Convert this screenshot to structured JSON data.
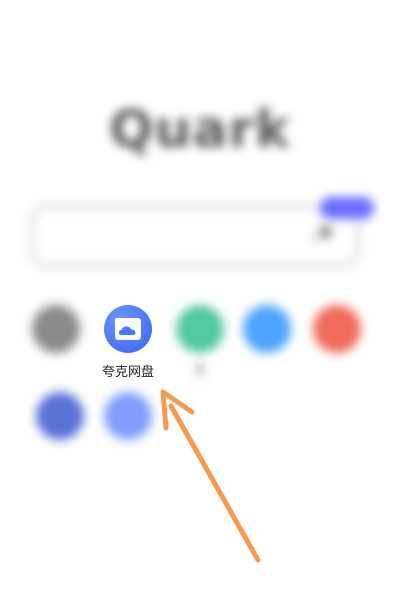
{
  "logo": {
    "text": "Quark"
  },
  "search": {
    "placeholder": ""
  },
  "shortcuts": [
    {
      "label": "",
      "color": "#8a8a8a",
      "icon": "app-icon"
    },
    {
      "label": "夸克网盘",
      "color": "#4a73ff",
      "icon": "cloud-drive-icon"
    },
    {
      "label": "大",
      "color": "#53c9a3",
      "icon": "app-icon"
    },
    {
      "label": "",
      "color": "#4ea3ff",
      "icon": "app-icon"
    },
    {
      "label": "",
      "color": "#f06b5a",
      "icon": "app-icon"
    },
    {
      "label": "",
      "color": "#5a72d8",
      "icon": "app-icon"
    },
    {
      "label": "",
      "color": "#7f9dff",
      "icon": "app-icon"
    }
  ],
  "annotation": {
    "arrow_color": "#f59a50"
  }
}
